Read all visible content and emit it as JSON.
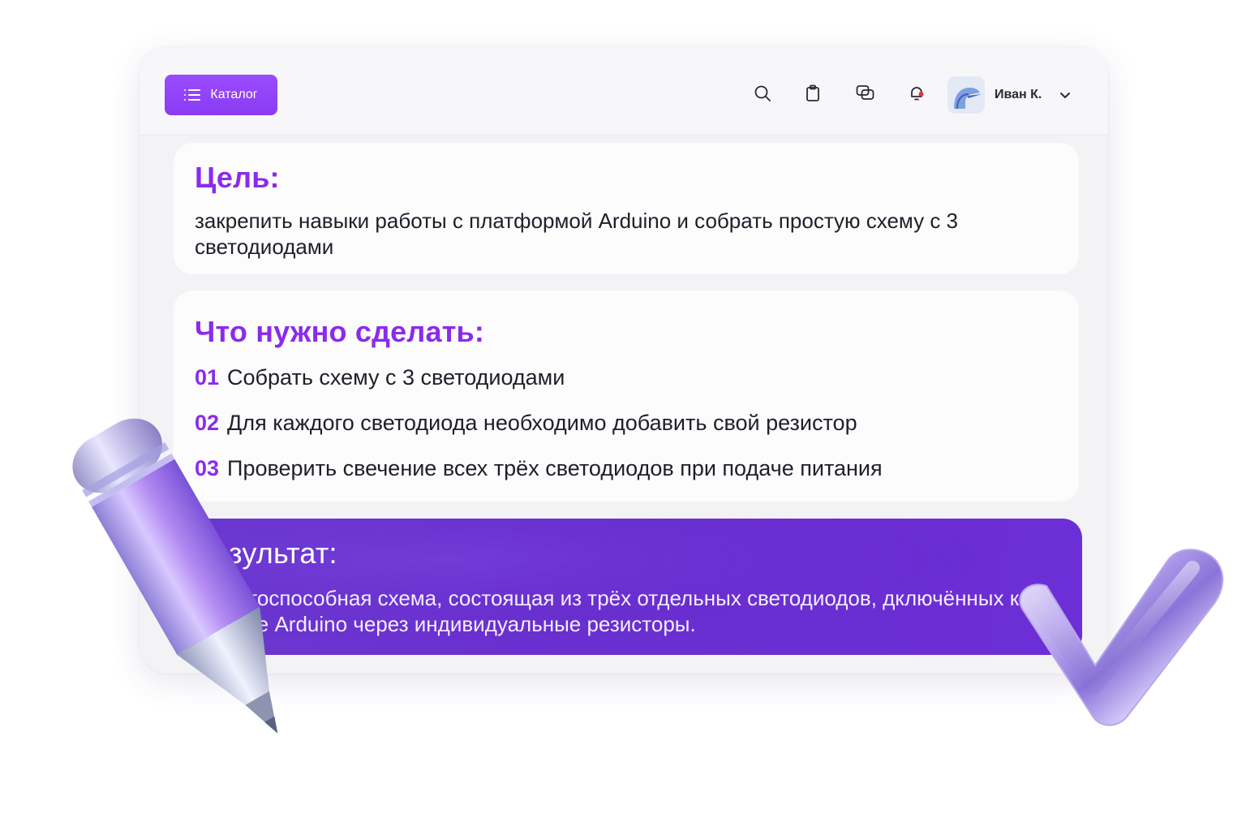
{
  "header": {
    "catalog_label": "Каталог",
    "user_name": "Иван К.",
    "icons": [
      "search-icon",
      "clipboard-icon",
      "chat-icon",
      "notification-icon",
      "chevron-down-icon"
    ]
  },
  "goal": {
    "title": "Цель:",
    "text": "закрепить навыки работы с платформой Arduino и собрать простую схему с 3 светодиодами"
  },
  "todo": {
    "title": "Что нужно сделать:",
    "items": [
      {
        "num": "01",
        "text": "Собрать схему с 3 светодиодами"
      },
      {
        "num": "02",
        "text": "Для каждого светодиода необходимо добавить свой резистор"
      },
      {
        "num": "03",
        "text": "Проверить свечение всех трёх светодиодов при подаче питания"
      }
    ]
  },
  "result": {
    "title": "Результат:",
    "text": "аботоспособная схема, состоящая из трёх отдельных светодиодов, дключённых к плате Arduino через индивидуальные резисторы."
  },
  "colors": {
    "accent": "#8b2bea",
    "button": "#9b4bff",
    "result_bg": "#6a2fcf",
    "text": "#1f1f29"
  }
}
